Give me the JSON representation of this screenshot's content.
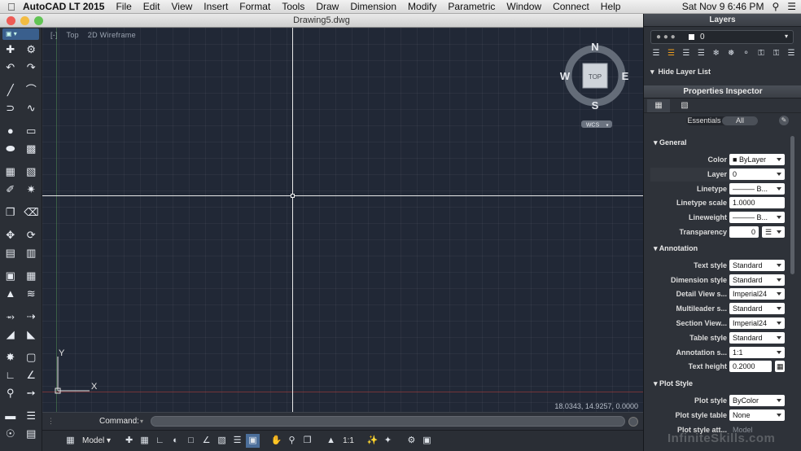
{
  "menubar": {
    "app_name": "AutoCAD LT 2015",
    "items": [
      "File",
      "Edit",
      "View",
      "Insert",
      "Format",
      "Tools",
      "Draw",
      "Dimension",
      "Modify",
      "Parametric",
      "Window",
      "Connect",
      "Help"
    ],
    "clock": "Sat Nov 9  6:46 PM"
  },
  "window": {
    "title": "Drawing5.dwg"
  },
  "viewport": {
    "view_name": "Top",
    "visual_style": "2D Wireframe",
    "coords": "18.0343, 14.9257, 0.0000",
    "ucs_y": "Y",
    "ucs_x": "X"
  },
  "viewcube": {
    "north": "N",
    "south": "S",
    "east": "E",
    "west": "W",
    "face": "TOP",
    "wcs": "WCS"
  },
  "command": {
    "label": "Command:",
    "value": ""
  },
  "statusbar": {
    "model_label": "Model",
    "scale": "1:1"
  },
  "layers_panel": {
    "title": "Layers",
    "current_layer": "0",
    "hide_list_label": "Hide Layer List"
  },
  "properties": {
    "title": "Properties Inspector",
    "seg_essentials": "Essentials",
    "seg_all": "All",
    "sections": {
      "general": "General",
      "annotation": "Annotation",
      "plot_style": "Plot Style"
    },
    "general": [
      {
        "label": "Color",
        "value": "ByLayer"
      },
      {
        "label": "Layer",
        "value": "0"
      },
      {
        "label": "Linetype",
        "value": "B..."
      },
      {
        "label": "Linetype scale",
        "value": "1.0000"
      },
      {
        "label": "Lineweight",
        "value": "B..."
      },
      {
        "label": "Transparency",
        "value": "0"
      }
    ],
    "annotation": [
      {
        "label": "Text style",
        "value": "Standard"
      },
      {
        "label": "Dimension style",
        "value": "Standard"
      },
      {
        "label": "Detail View s...",
        "value": "Imperial24"
      },
      {
        "label": "Multileader s...",
        "value": "Standard"
      },
      {
        "label": "Section View...",
        "value": "Imperial24"
      },
      {
        "label": "Table style",
        "value": "Standard"
      },
      {
        "label": "Annotation s...",
        "value": "1:1"
      },
      {
        "label": "Text height",
        "value": "0.2000"
      }
    ],
    "plot_style": [
      {
        "label": "Plot style",
        "value": "ByColor"
      },
      {
        "label": "Plot style table",
        "value": "None"
      },
      {
        "label": "Plot style att...",
        "value": "Model"
      }
    ]
  },
  "watermark": "InfiniteSkills.com",
  "colors": {
    "canvas": "#212836",
    "crosshair": "#e8e8e8",
    "panel": "#2e3239",
    "accent": "#3a5f8d"
  }
}
